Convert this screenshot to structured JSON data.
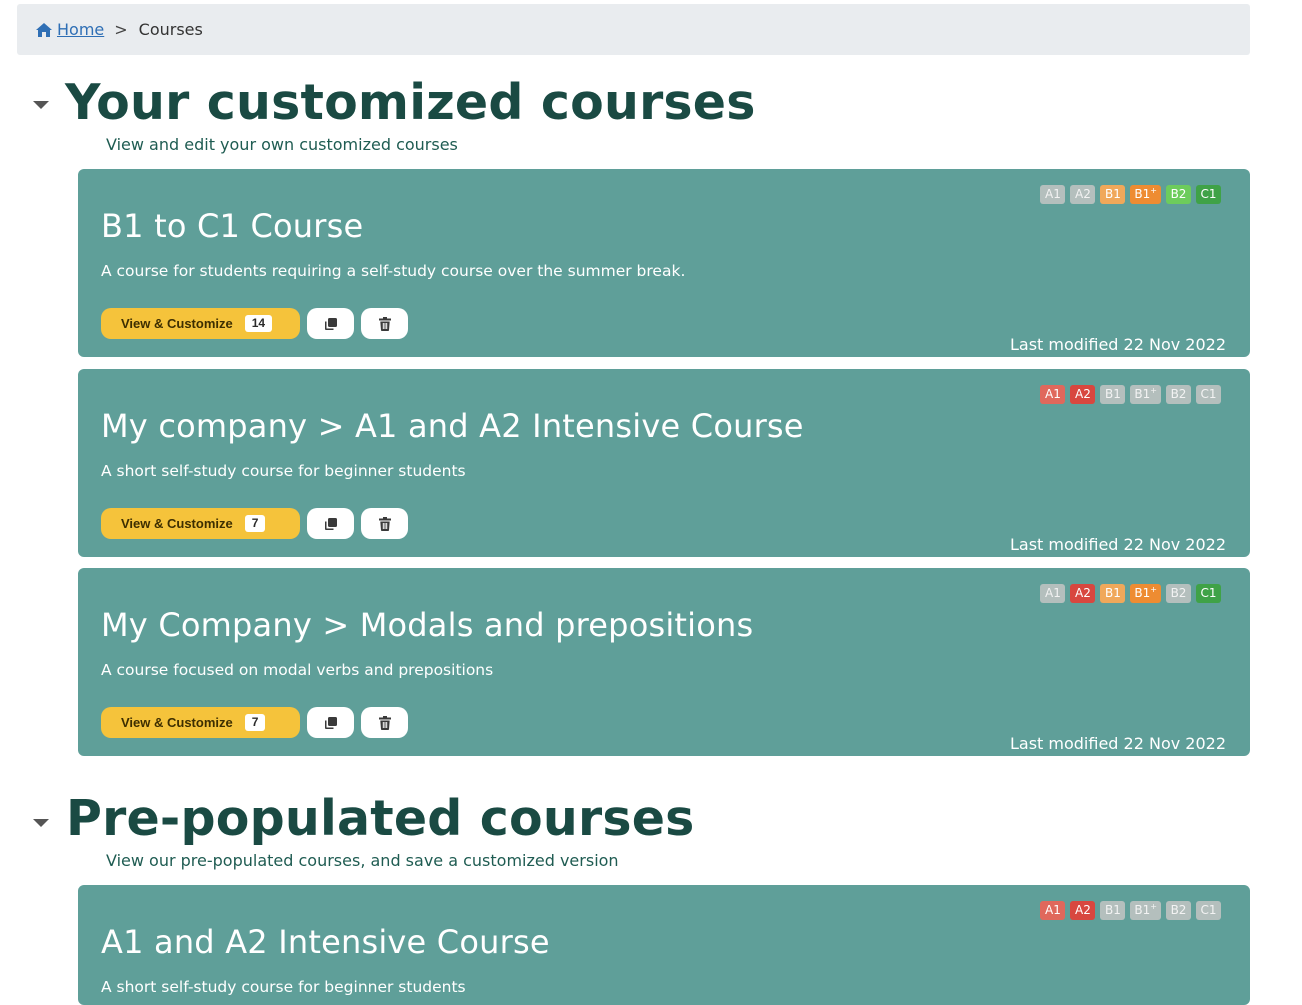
{
  "breadcrumb": {
    "home": "Home",
    "separator": ">",
    "current": "Courses"
  },
  "sections": [
    {
      "title": "Your customized courses",
      "subtitle": "View and edit your own customized courses",
      "courses": [
        {
          "title": "B1 to C1 Course",
          "description": "A course for students requiring a self-study course over the summer break.",
          "view_label": "View & Customize",
          "count": "14",
          "modified": "Last modified 22 Nov 2022",
          "levels": [
            {
              "label": "A1",
              "status": "inactive"
            },
            {
              "label": "A2",
              "status": "inactive"
            },
            {
              "label": "B1",
              "status": "active"
            },
            {
              "label": "B1",
              "status": "active"
            },
            {
              "label": "B2",
              "status": "active"
            },
            {
              "label": "C1",
              "status": "active"
            }
          ]
        },
        {
          "title": "My company > A1 and A2 Intensive Course",
          "description": "A short self-study course for beginner students",
          "view_label": "View & Customize",
          "count": "7",
          "modified": "Last modified 22 Nov 2022",
          "levels": [
            {
              "label": "A1",
              "status": "active"
            },
            {
              "label": "A2",
              "status": "active"
            },
            {
              "label": "B1",
              "status": "inactive"
            },
            {
              "label": "B1",
              "status": "inactive"
            },
            {
              "label": "B2",
              "status": "inactive"
            },
            {
              "label": "C1",
              "status": "inactive"
            }
          ]
        },
        {
          "title": "My Company > Modals and prepositions",
          "description": "A course focused on modal verbs and prepositions",
          "view_label": "View & Customize",
          "count": "7",
          "modified": "Last modified 22 Nov 2022",
          "levels": [
            {
              "label": "A1",
              "status": "inactive"
            },
            {
              "label": "A2",
              "status": "active"
            },
            {
              "label": "B1",
              "status": "active"
            },
            {
              "label": "B1",
              "status": "active"
            },
            {
              "label": "B2",
              "status": "inactive"
            },
            {
              "label": "C1",
              "status": "active"
            }
          ]
        }
      ]
    },
    {
      "title": "Pre-populated courses",
      "subtitle": "View our pre-populated courses, and save a customized version",
      "courses": [
        {
          "title": "A1 and A2 Intensive Course",
          "description": "A short self-study course for beginner students",
          "levels": [
            {
              "label": "A1",
              "status": "active"
            },
            {
              "label": "A2",
              "status": "active"
            },
            {
              "label": "B1",
              "status": "inactive"
            },
            {
              "label": "B1",
              "status": "inactive"
            },
            {
              "label": "B2",
              "status": "inactive"
            },
            {
              "label": "C1",
              "status": "inactive"
            }
          ]
        }
      ]
    }
  ],
  "level_colors": {
    "A1": "#e0685c",
    "A2": "#d8473f",
    "B1": "#f0a85a",
    "B1+": "#ee8c32",
    "B2": "#6dcc5c",
    "C1": "#3fa247",
    "inactive": "#b4bfbd"
  },
  "icons": {
    "home": "home-icon",
    "copy": "copy-icon",
    "delete": "trash-icon",
    "toggle": "caret-down-icon"
  }
}
